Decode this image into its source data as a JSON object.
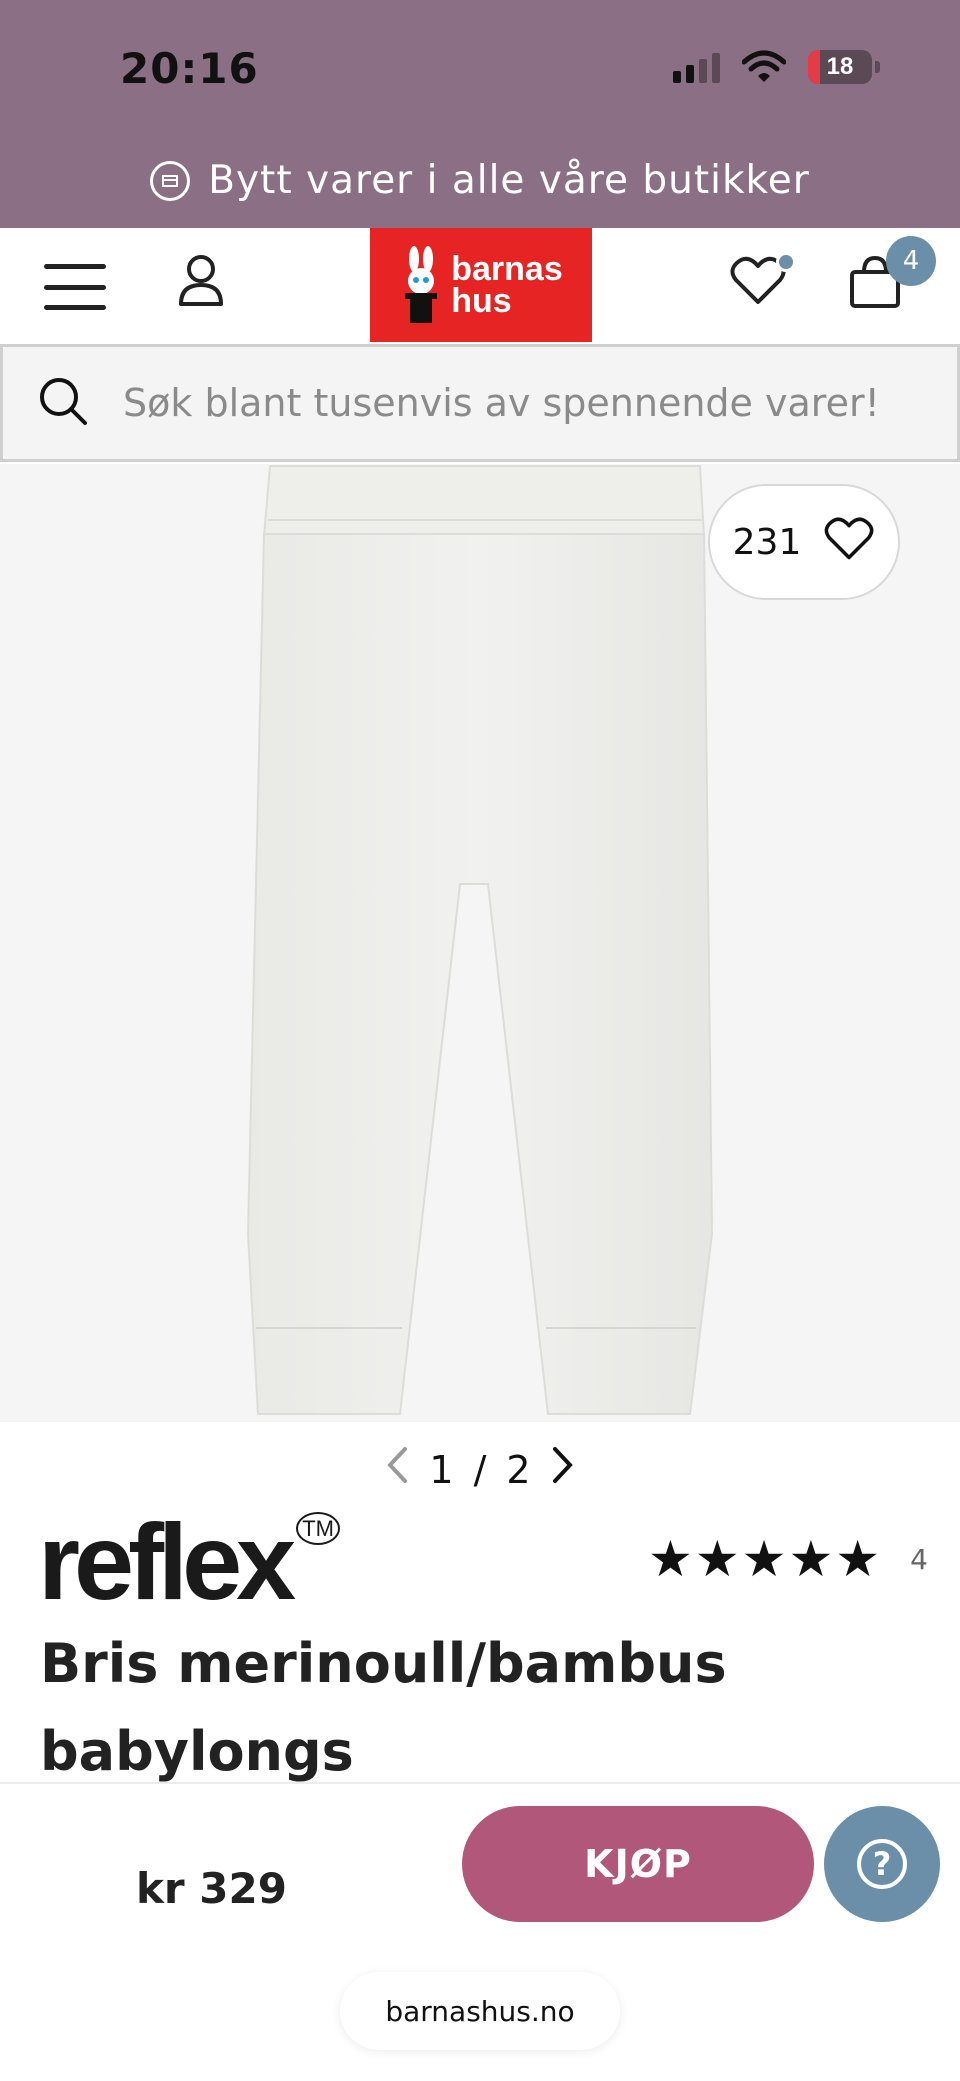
{
  "status_bar": {
    "time": "20:16",
    "battery_level": "18"
  },
  "promo": {
    "text": "Bytt varer i alle våre butikker",
    "icon": "exchange-icon"
  },
  "header": {
    "logo_line1": "barnas",
    "logo_line2": "hus",
    "cart_count": "4",
    "brand_color": "#e62424"
  },
  "search": {
    "placeholder": "Søk blant tusenvis av spennende varer!"
  },
  "product": {
    "likes": "231",
    "image_index": "1",
    "image_total": "2",
    "image_separator": "/",
    "brand": "reflex",
    "brand_mark": "TM",
    "rating_stars": "★★★★★",
    "rating_count": "4",
    "title": "Bris merinoull/bambus babylongs"
  },
  "purchase": {
    "price": "kr 329",
    "buy_label": "KJØP",
    "buy_color": "#b0577a",
    "help_color": "#6b8fa8"
  },
  "browser": {
    "url": "barnashus.no"
  },
  "colors": {
    "topbar": "#8b6f84",
    "badge": "#6b8fa8"
  }
}
